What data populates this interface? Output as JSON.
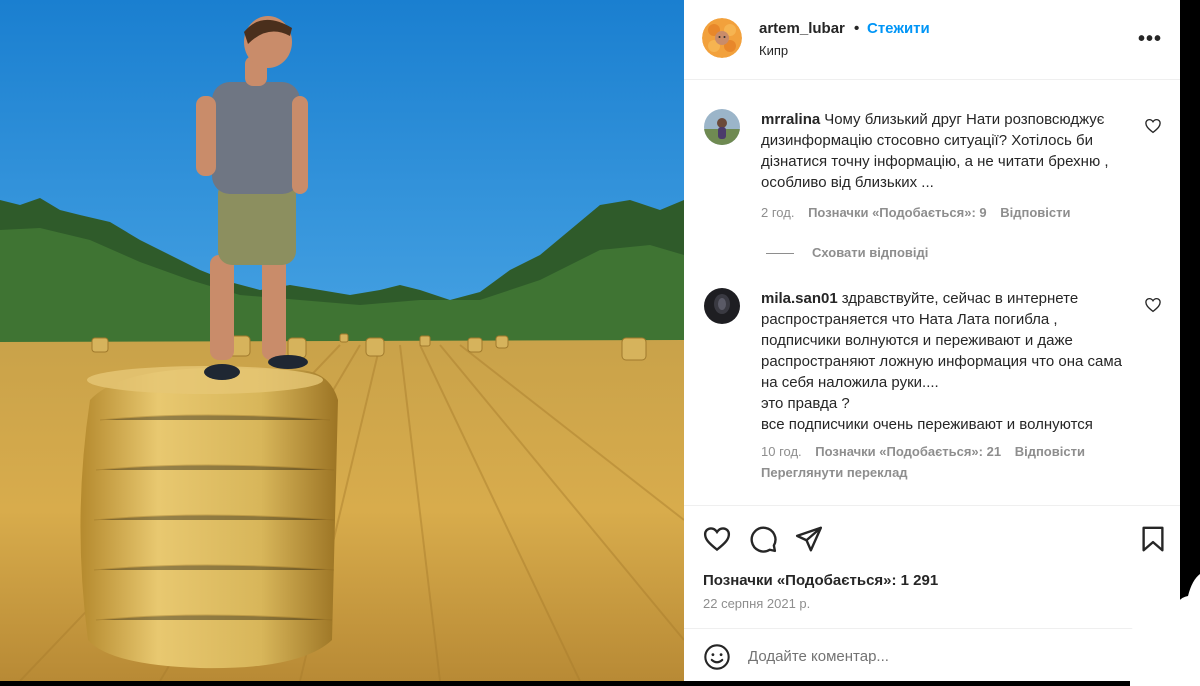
{
  "post": {
    "author": "artem_lubar",
    "dot": "•",
    "follow_label": "Стежити",
    "location": "Кипр",
    "more_label": "•••"
  },
  "comments": [
    {
      "user": "mrralina",
      "text": "Чому близький друг Нати розповсюджує дизинформацію стосовно ситуації? Хотілось би дізнатися точну інформацію, а не читати брехню , особливо від близьких ...",
      "time": "2 год.",
      "likes": "Позначки «Подобається»: 9",
      "reply": "Відповісти"
    },
    {
      "user": "mila.san01",
      "text": "здравствуйте, сейчас в интернете распространяется что Ната Лата погибла , подписчики волнуются и переживают и даже распространяют ложную информация что она сама на себя наложила руки....\nэто правда ?\nвсе подписчики очень переживают и волнуются",
      "time": "10 год.",
      "likes": "Позначки «Подобається»: 21",
      "reply": "Відповісти",
      "translate": "Переглянути переклад"
    }
  ],
  "hide_replies": "Сховати відповіді",
  "actions": {
    "icons": [
      "heart-icon",
      "comment-icon",
      "share-icon",
      "bookmark-icon"
    ],
    "likes": "Позначки «Подобається»: 1 291",
    "date": "22 серпня 2021 р."
  },
  "add_comment": {
    "placeholder": "Додайте коментар..."
  },
  "colors": {
    "accent": "#0095f6",
    "muted": "#8e8e8e",
    "text": "#262626"
  }
}
